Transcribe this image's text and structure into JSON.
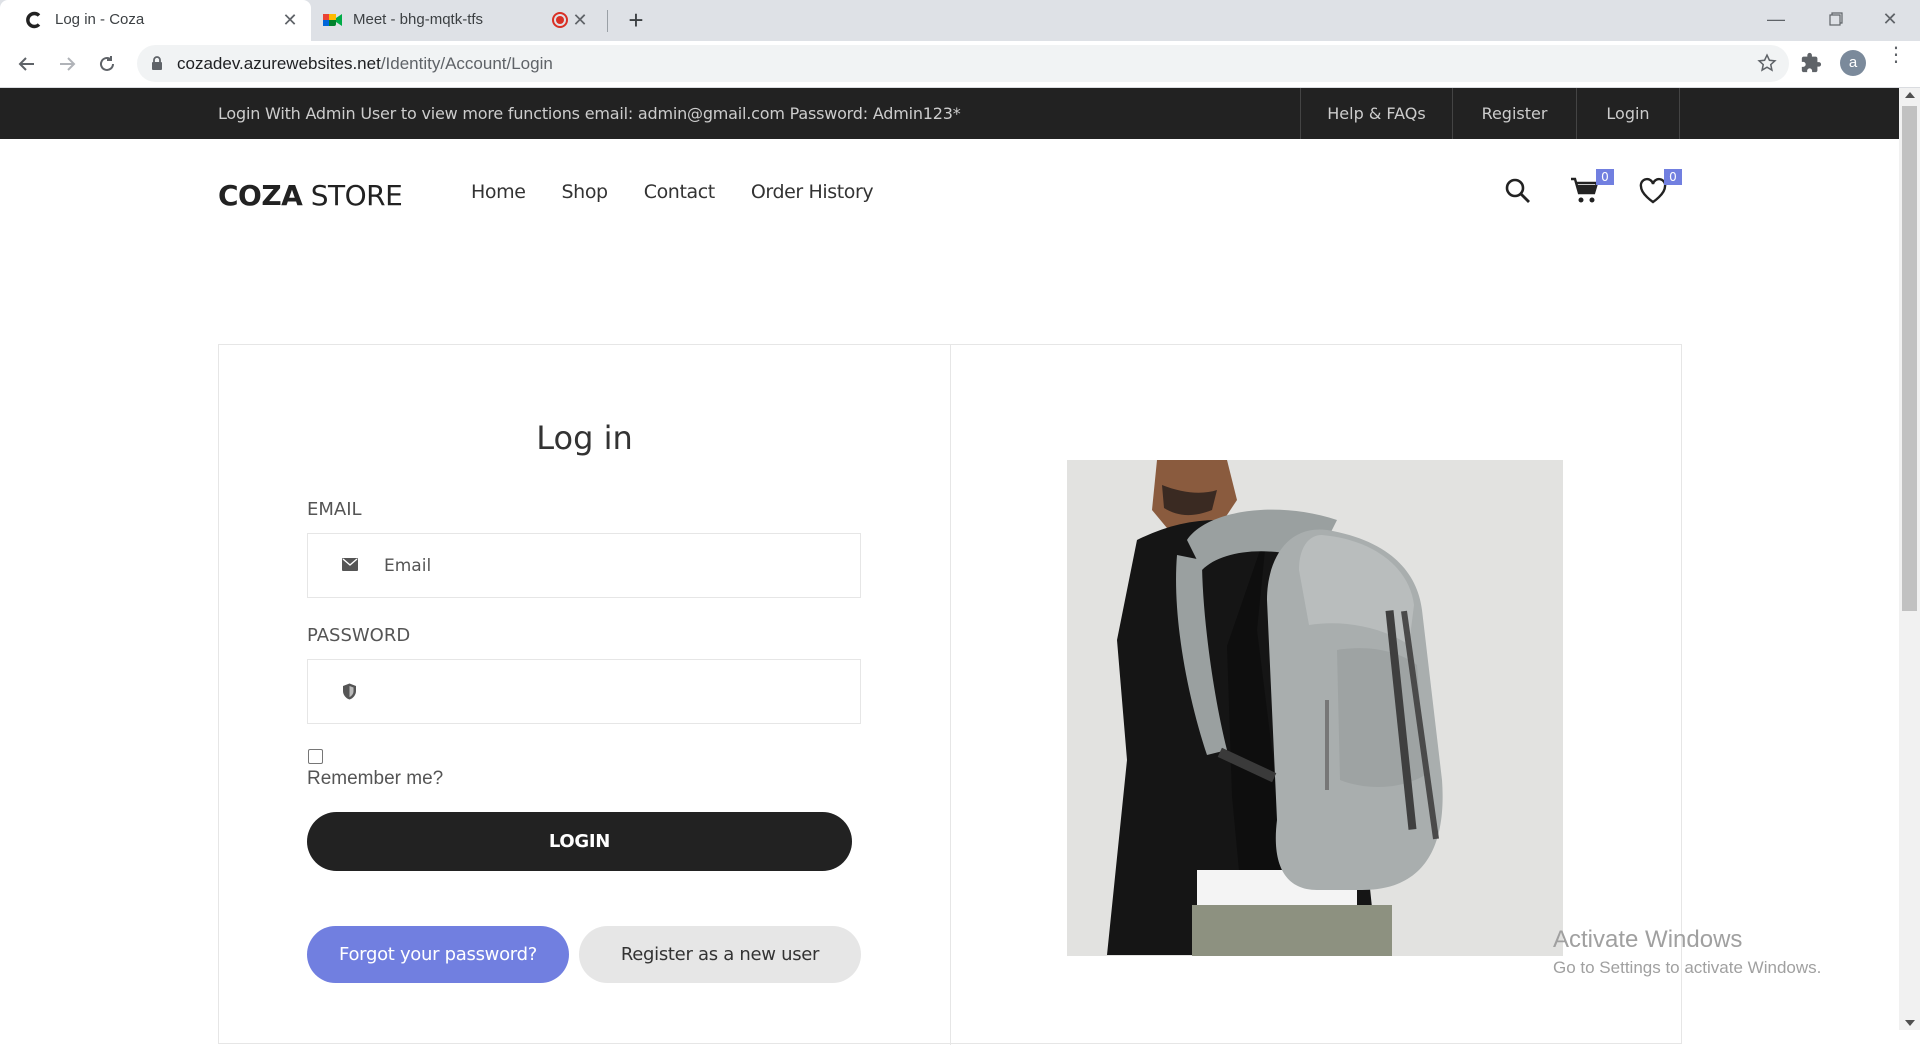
{
  "browser": {
    "tabs": [
      {
        "title": "Log in - Coza",
        "active": true
      },
      {
        "title": "Meet - bhg-mqtk-tfs",
        "active": false,
        "recording": true
      }
    ],
    "url_host": "cozadev.azurewebsites.net",
    "url_path": "/Identity/Account/Login",
    "profile_initial": "a"
  },
  "topbar": {
    "notice": "Login With Admin User to view more functions  email: admin@gmail.com  Password: Admin123*",
    "links": [
      "Help & FAQs",
      "Register",
      "Login"
    ]
  },
  "header": {
    "logo_bold": "COZA",
    "logo_light": " STORE",
    "nav": [
      "Home",
      "Shop",
      "Contact",
      "Order History"
    ],
    "cart_count": "0",
    "wishlist_count": "0"
  },
  "login": {
    "title": "Log in",
    "email_label": "EMAIL",
    "email_placeholder": "Email",
    "password_label": "PASSWORD",
    "remember_label": "Remember me?",
    "remember_checked": false,
    "login_button": "LOGIN",
    "forgot_button": "Forgot your password?",
    "register_button": "Register as a new user"
  },
  "watermark": {
    "line1": "Activate Windows",
    "line2": "Go to Settings to activate Windows."
  },
  "colors": {
    "accent": "#717fe0",
    "dark": "#222222",
    "light_button": "#e6e6e6"
  }
}
